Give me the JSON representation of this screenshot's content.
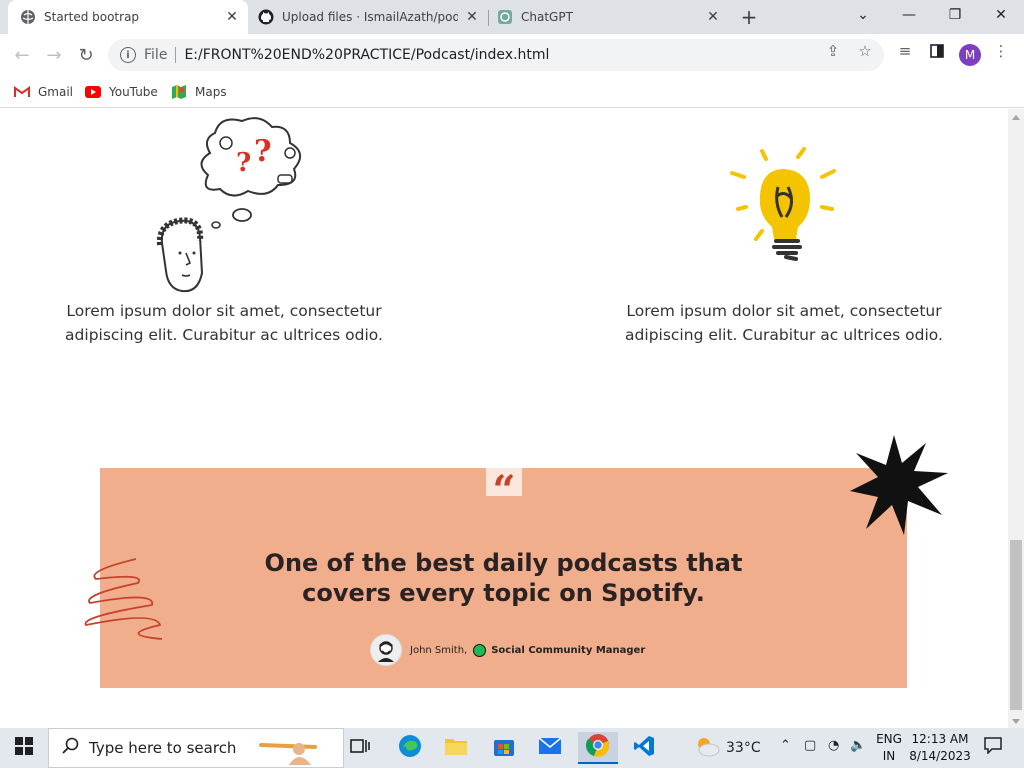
{
  "browser": {
    "tabs": [
      {
        "title": "Started bootrap",
        "active": true
      },
      {
        "title": "Upload files · IsmailAzath/podcas",
        "active": false
      },
      {
        "title": "ChatGPT",
        "active": false
      }
    ],
    "address": {
      "scheme_label": "File",
      "url": "E:/FRONT%20END%20PRACTICE/Podcast/index.html"
    },
    "bookmarks": [
      {
        "label": "Gmail",
        "icon": "gmail-icon"
      },
      {
        "label": "YouTube",
        "icon": "youtube-icon"
      },
      {
        "label": "Maps",
        "icon": "maps-icon"
      }
    ],
    "profile_initial": "M"
  },
  "page": {
    "features": [
      {
        "text": "Lorem ipsum dolor sit amet, consectetur adipiscing elit. Curabitur ac ultrices odio.",
        "icon": "thinking-person-icon"
      },
      {
        "text": "Lorem ipsum dolor sit amet, consectetur adipiscing elit. Curabitur ac ultrices odio.",
        "icon": "lightbulb-icon"
      }
    ],
    "testimonial": {
      "quote_mark": "“",
      "quote": "One of the best daily podcasts that covers every topic on Spotify.",
      "author": "John Smith,",
      "role": "Social Community Manager"
    },
    "colors": {
      "card": "#f0ae8d",
      "accent": "#c6432a",
      "star": "#111111"
    }
  },
  "taskbar": {
    "search_placeholder": "Type here to search",
    "weather": "33°C",
    "language": {
      "line1": "ENG",
      "line2": "IN"
    },
    "time": "12:13 AM",
    "date": "8/14/2023"
  }
}
